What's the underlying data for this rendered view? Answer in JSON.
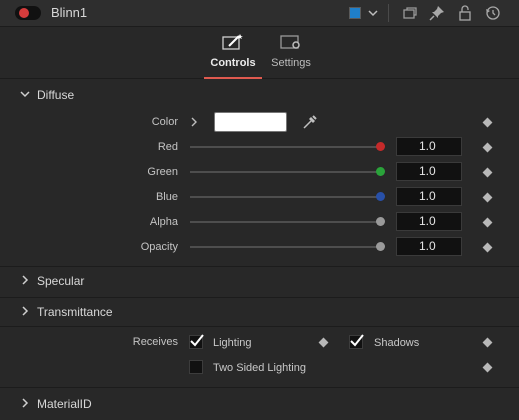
{
  "window": {
    "title": "Blinn1",
    "color_chip": "#1f7fc9",
    "accent": "#e05a4f"
  },
  "header_icons": [
    "tile-icon",
    "pin-icon",
    "lock-icon",
    "reset-icon"
  ],
  "tabs": [
    {
      "label": "Controls",
      "icon": "controls-wand-icon",
      "active": true
    },
    {
      "label": "Settings",
      "icon": "settings-gear-icon",
      "active": false
    }
  ],
  "diffuse": {
    "title": "Diffuse",
    "color_label": "Color",
    "color_value": "#ffffff",
    "channels": [
      {
        "label": "Red",
        "value": "1.0",
        "knob": "#c52a2a"
      },
      {
        "label": "Green",
        "value": "1.0",
        "knob": "#2aa33a"
      },
      {
        "label": "Blue",
        "value": "1.0",
        "knob": "#2850a8"
      },
      {
        "label": "Alpha",
        "value": "1.0",
        "knob": "#9a9a9a"
      },
      {
        "label": "Opacity",
        "value": "1.0",
        "knob": "#9a9a9a"
      }
    ]
  },
  "sections": {
    "specular": "Specular",
    "transmittance": "Transmittance",
    "material_id": "MaterialID"
  },
  "receives": {
    "label": "Receives",
    "lighting": {
      "label": "Lighting",
      "checked": true
    },
    "shadows": {
      "label": "Shadows",
      "checked": true
    },
    "two_sided": {
      "label": "Two Sided Lighting",
      "checked": false
    }
  }
}
